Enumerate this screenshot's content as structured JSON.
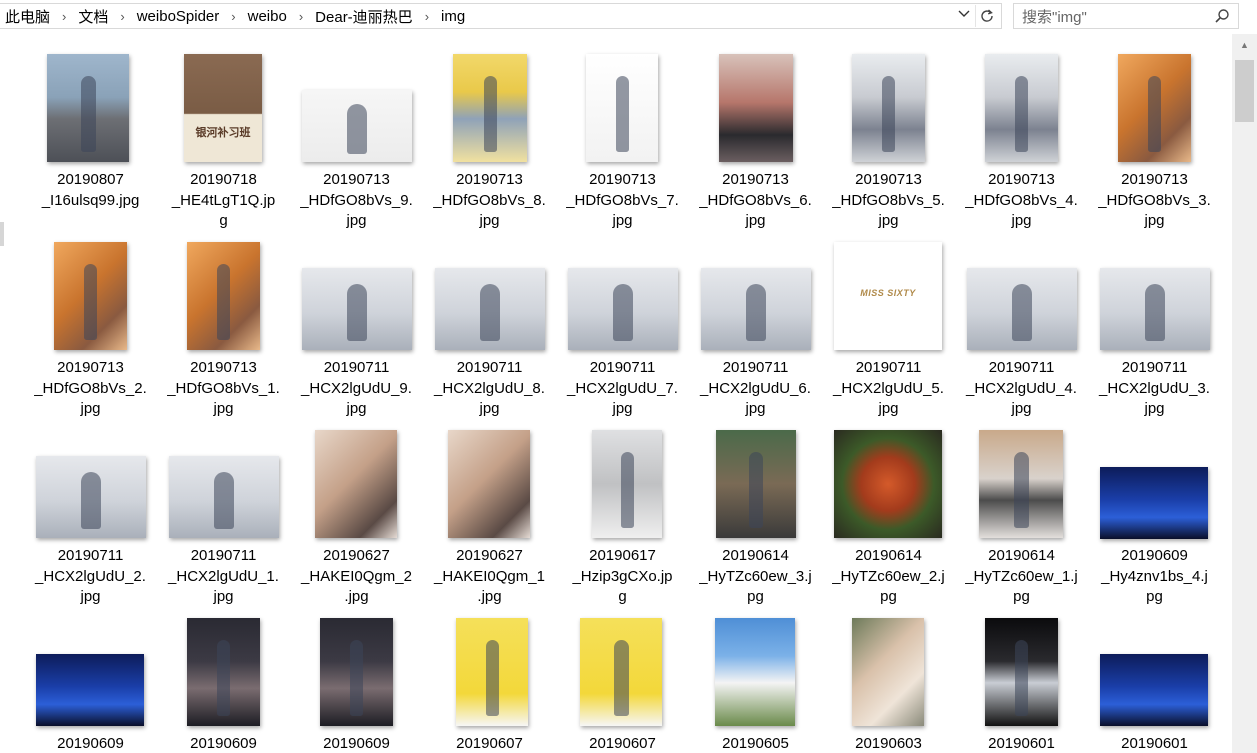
{
  "address": {
    "crumbs": [
      "此电脑",
      "文档",
      "weiboSpider",
      "weibo",
      "Dear-迪丽热巴",
      "img"
    ],
    "separator": "›"
  },
  "search": {
    "placeholder": "搜索\"img\""
  },
  "files": [
    {
      "l1": "20190807",
      "l2": "_I16ulsq99.jpg",
      "l3": ""
    },
    {
      "l1": "20190718",
      "l2": "_HE4tLgT1Q.jp",
      "l3": "g"
    },
    {
      "l1": "20190713",
      "l2": "_HDfGO8bVs_9.",
      "l3": "jpg"
    },
    {
      "l1": "20190713",
      "l2": "_HDfGO8bVs_8.",
      "l3": "jpg"
    },
    {
      "l1": "20190713",
      "l2": "_HDfGO8bVs_7.",
      "l3": "jpg"
    },
    {
      "l1": "20190713",
      "l2": "_HDfGO8bVs_6.",
      "l3": "jpg"
    },
    {
      "l1": "20190713",
      "l2": "_HDfGO8bVs_5.",
      "l3": "jpg"
    },
    {
      "l1": "20190713",
      "l2": "_HDfGO8bVs_4.",
      "l3": "jpg"
    },
    {
      "l1": "20190713",
      "l2": "_HDfGO8bVs_3.",
      "l3": "jpg"
    },
    {
      "l1": "20190713",
      "l2": "_HDfGO8bVs_2.",
      "l3": "jpg"
    },
    {
      "l1": "20190713",
      "l2": "_HDfGO8bVs_1.",
      "l3": "jpg"
    },
    {
      "l1": "20190711",
      "l2": "_HCX2lgUdU_9.",
      "l3": "jpg"
    },
    {
      "l1": "20190711",
      "l2": "_HCX2lgUdU_8.",
      "l3": "jpg"
    },
    {
      "l1": "20190711",
      "l2": "_HCX2lgUdU_7.",
      "l3": "jpg"
    },
    {
      "l1": "20190711",
      "l2": "_HCX2lgUdU_6.",
      "l3": "jpg"
    },
    {
      "l1": "20190711",
      "l2": "_HCX2lgUdU_5.",
      "l3": "jpg"
    },
    {
      "l1": "20190711",
      "l2": "_HCX2lgUdU_4.",
      "l3": "jpg"
    },
    {
      "l1": "20190711",
      "l2": "_HCX2lgUdU_3.",
      "l3": "jpg"
    },
    {
      "l1": "20190711",
      "l2": "_HCX2lgUdU_2.",
      "l3": "jpg"
    },
    {
      "l1": "20190711",
      "l2": "_HCX2lgUdU_1.",
      "l3": "jpg"
    },
    {
      "l1": "20190627",
      "l2": "_HAKEI0Qgm_2",
      "l3": ".jpg"
    },
    {
      "l1": "20190627",
      "l2": "_HAKEI0Qgm_1",
      "l3": ".jpg"
    },
    {
      "l1": "20190617",
      "l2": "_Hzip3gCXo.jp",
      "l3": "g"
    },
    {
      "l1": "20190614",
      "l2": "_HyTZc60ew_3.j",
      "l3": "pg"
    },
    {
      "l1": "20190614",
      "l2": "_HyTZc60ew_2.j",
      "l3": "pg"
    },
    {
      "l1": "20190614",
      "l2": "_HyTZc60ew_1.j",
      "l3": "pg"
    },
    {
      "l1": "20190609",
      "l2": "_Hy4znv1bs_4.j",
      "l3": "pg"
    },
    {
      "l1": "20190609",
      "l2": "",
      "l3": ""
    },
    {
      "l1": "20190609",
      "l2": "",
      "l3": ""
    },
    {
      "l1": "20190609",
      "l2": "",
      "l3": ""
    },
    {
      "l1": "20190607",
      "l2": "",
      "l3": ""
    },
    {
      "l1": "20190607",
      "l2": "",
      "l3": ""
    },
    {
      "l1": "20190605",
      "l2": "",
      "l3": ""
    },
    {
      "l1": "20190603",
      "l2": "",
      "l3": ""
    },
    {
      "l1": "20190601",
      "l2": "",
      "l3": ""
    },
    {
      "l1": "20190601",
      "l2": "",
      "l3": ""
    }
  ],
  "thumb_text": {
    "poster_2": "银河补习班",
    "miss_sixty": "MISS SIXTY"
  },
  "colors": {
    "addr_border": "#d9d9d9",
    "scrollbar_track": "#f0f0f0",
    "scrollbar_thumb": "#cdcdcd"
  }
}
